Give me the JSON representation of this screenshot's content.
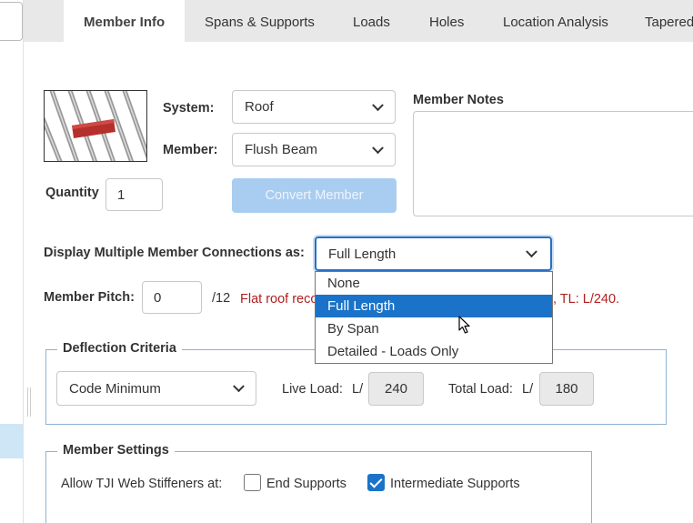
{
  "tabs": [
    {
      "label": "Member Info",
      "active": true
    },
    {
      "label": "Spans & Supports"
    },
    {
      "label": "Loads"
    },
    {
      "label": "Holes"
    },
    {
      "label": "Location Analysis"
    },
    {
      "label": "Tapered"
    }
  ],
  "member": {
    "system_label": "System:",
    "system_value": "Roof",
    "member_label": "Member:",
    "member_value": "Flush Beam",
    "quantity_label": "Quantity",
    "quantity_value": "1",
    "convert_label": "Convert Member",
    "notes_label": "Member Notes",
    "notes_value": ""
  },
  "connections": {
    "label": "Display Multiple Member Connections as:",
    "value": "Full Length",
    "options": [
      "None",
      "Full Length",
      "By Span",
      "Detailed - Loads Only"
    ],
    "selected_index": 1
  },
  "pitch": {
    "label": "Member Pitch:",
    "value": "0",
    "unit": "/12",
    "warning_left": "Flat roof reco",
    "warning_right": ", TL: L/240."
  },
  "deflection": {
    "legend": "Deflection Criteria",
    "criteria_value": "Code Minimum",
    "live_label": "Live Load:",
    "live_prefix": "L/",
    "live_value": "240",
    "total_label": "Total Load:",
    "total_prefix": "L/",
    "total_value": "180"
  },
  "settings": {
    "legend": "Member Settings",
    "stiffeners_label": "Allow TJI Web Stiffeners at:",
    "end_supports_label": "End Supports",
    "end_supports_checked": false,
    "intermediate_label": "Intermediate Supports",
    "intermediate_checked": true
  },
  "colors": {
    "accent": "#1a73c8",
    "warning": "#b0201f",
    "disabled_button": "#a9cdf1",
    "fieldset_border": "#8fb2d1"
  }
}
